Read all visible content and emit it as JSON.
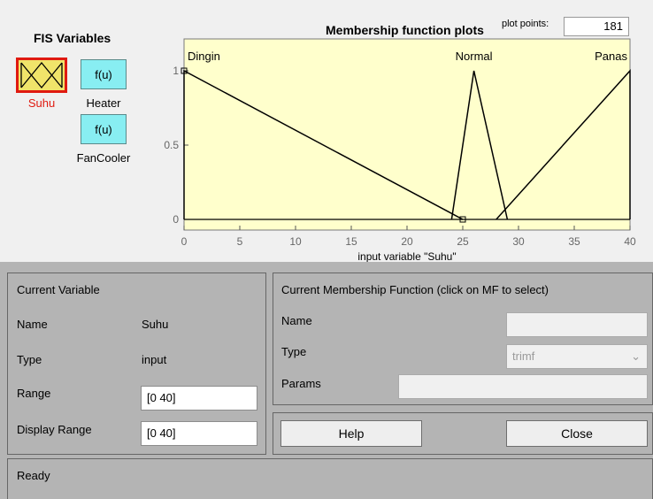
{
  "fis": {
    "title": "FIS Variables",
    "inputs": [
      {
        "box": "",
        "label": "Suhu",
        "icon": "triangle-mf-icon",
        "selected": true
      }
    ],
    "outputs": [
      {
        "box": "f(u)",
        "label": "Heater"
      },
      {
        "box": "f(u)",
        "label": "FanCooler"
      }
    ]
  },
  "plot": {
    "title": "Membership function plots",
    "plot_points_label": "plot points:",
    "plot_points_value": "181"
  },
  "chart_data": {
    "type": "line",
    "xlabel": "input variable \"Suhu\"",
    "xlim": [
      0,
      40
    ],
    "ylim": [
      0,
      1
    ],
    "xticks": [
      "0",
      "5",
      "10",
      "15",
      "20",
      "25",
      "30",
      "35",
      "40"
    ],
    "yticks": [
      "0",
      "0.5",
      "1"
    ],
    "series": [
      {
        "name": "Dingin",
        "x": [
          0,
          0,
          25
        ],
        "y": [
          0,
          1,
          0
        ]
      },
      {
        "name": "Normal",
        "x": [
          24,
          26,
          29
        ],
        "y": [
          0,
          1,
          0
        ]
      },
      {
        "name": "Panas",
        "x": [
          28,
          40,
          40
        ],
        "y": [
          0,
          1,
          0
        ]
      }
    ],
    "background": "#ffffcc",
    "line_color": "#000000"
  },
  "current_variable": {
    "title": "Current Variable",
    "name_label": "Name",
    "name_value": "Suhu",
    "type_label": "Type",
    "type_value": "input",
    "range_label": "Range",
    "range_value": "[0 40]",
    "display_range_label": "Display Range",
    "display_range_value": "[0 40]"
  },
  "current_mf": {
    "title": "Current Membership Function (click on MF to select)",
    "name_label": "Name",
    "name_value": "",
    "type_label": "Type",
    "type_value": "trimf",
    "params_label": "Params",
    "params_value": ""
  },
  "buttons": {
    "help": "Help",
    "close": "Close"
  },
  "status": {
    "text": "Ready"
  },
  "colors": {
    "selected_border": "#e01a10",
    "output_box": "#88eef2",
    "plot_bg": "#ffffcc",
    "panel_bg": "#b4b4b4"
  }
}
